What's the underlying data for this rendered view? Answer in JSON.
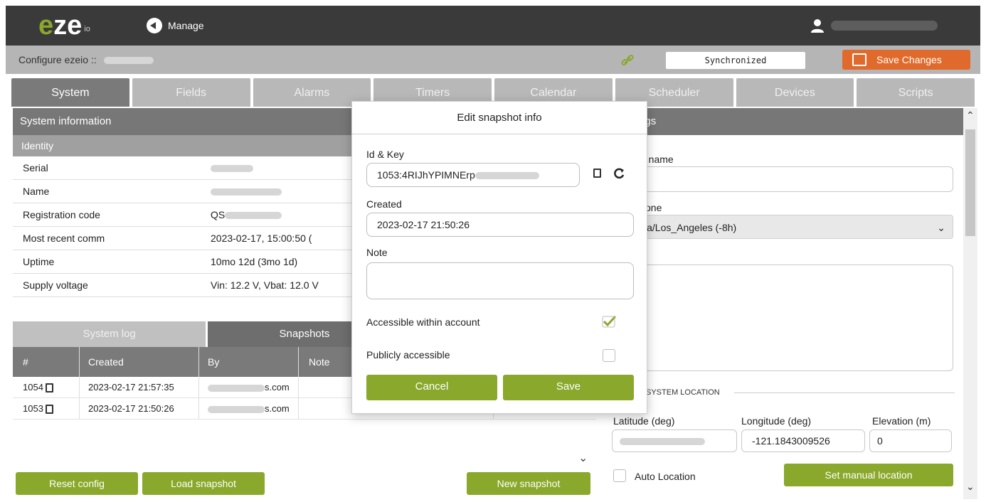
{
  "header": {
    "logo_text": "eze",
    "logo_suffix": "io",
    "manage_label": "Manage",
    "user_icon": "user-icon"
  },
  "config_bar": {
    "title": "Configure ezeio ::",
    "sync_status": "Synchronized",
    "save_changes_label": "Save Changes",
    "link_icon": "link-icon",
    "accent_color": "#e06a2b"
  },
  "tabs": [
    "System",
    "Fields",
    "Alarms",
    "Timers",
    "Calendar",
    "Scheduler",
    "Devices",
    "Scripts"
  ],
  "left": {
    "section_title": "System information",
    "identity_title": "Identity",
    "rows": [
      {
        "key": "Serial",
        "value": ""
      },
      {
        "key": "Name",
        "value": ""
      },
      {
        "key": "Registration code",
        "value": "QS"
      },
      {
        "key": "Most recent comm",
        "value": "2023-02-17, 15:00:50 ("
      },
      {
        "key": "Uptime",
        "value": "10mo 12d (3mo 1d)"
      },
      {
        "key": "Supply voltage",
        "value": "Vin: 12.2 V, Vbat: 12.0 V"
      }
    ],
    "subtabs": [
      "System log",
      "Snapshots"
    ],
    "table_headers": [
      "#",
      "Created",
      "By",
      "Note",
      ""
    ],
    "snapshots": [
      {
        "id": "1054",
        "created": "2023-02-17 21:57:35",
        "by": "s.com",
        "note": ""
      },
      {
        "id": "1053",
        "created": "2023-02-17 21:50:26",
        "by": "s.com",
        "note": ""
      }
    ],
    "buttons": {
      "reset": "Reset config",
      "load": "Load snapshot",
      "new": "New snapshot"
    }
  },
  "right": {
    "section_title": "n settings",
    "name_label": "n name",
    "name_value": "2",
    "timezone_label": "zone",
    "timezone_value": "ica/Los_Angeles (-8h)",
    "system_location_label": "SYSTEM LOCATION",
    "latitude_label": "Latitude (deg)",
    "longitude_label": "Longitude (deg)",
    "elevation_label": "Elevation (m)",
    "longitude_value": "-121.1843009526",
    "elevation_value": "0",
    "auto_location_label": "Auto Location",
    "set_manual_label": "Set manual location"
  },
  "modal": {
    "title": "Edit snapshot info",
    "id_key_label": "Id & Key",
    "id_key_value": "1053:4RIJhYPIMNErp",
    "created_label": "Created",
    "created_value": "2023-02-17 21:50:26",
    "note_label": "Note",
    "note_value": "",
    "accessible_label": "Accessible within account",
    "accessible_checked": true,
    "public_label": "Publicly accessible",
    "public_checked": false,
    "cancel_label": "Cancel",
    "save_label": "Save",
    "brand_green": "#8aa82b"
  }
}
